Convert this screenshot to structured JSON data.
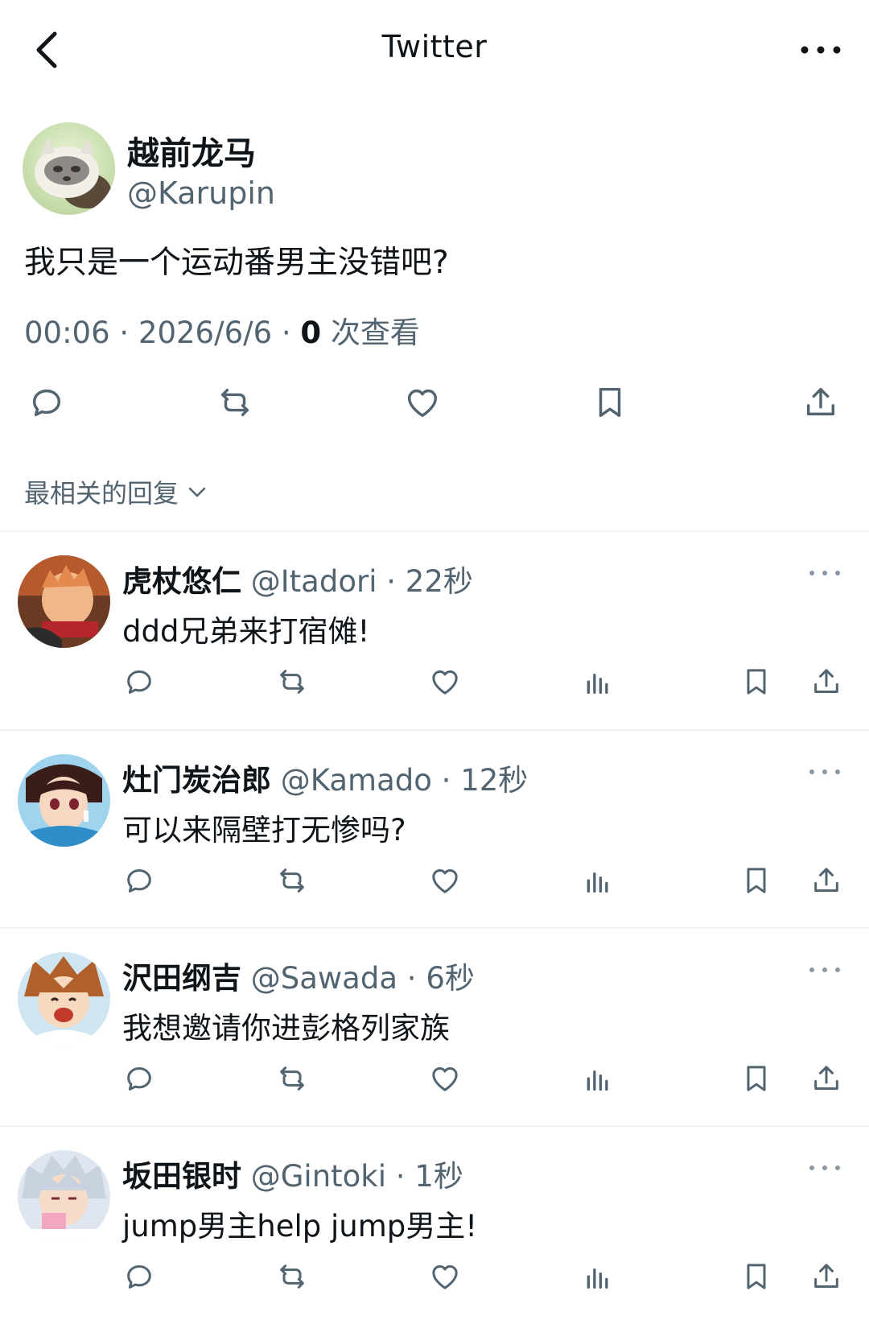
{
  "header": {
    "title": "Twitter"
  },
  "tweet": {
    "author_name": "越前龙马",
    "author_handle": "@Karupin",
    "text": "我只是一个运动番男主没错吧?",
    "time": "00:06",
    "sep1": "·",
    "date": "2026/6/6",
    "sep2": "·",
    "views_count": "0",
    "views_label": "次查看"
  },
  "replies_sort": {
    "label": "最相关的回复"
  },
  "replies": [
    {
      "name": "虎杖悠仁",
      "handle": "@Itadori",
      "dot": "·",
      "time": "22秒",
      "text": "ddd兄弟来打宿傩!"
    },
    {
      "name": "灶门炭治郎",
      "handle": "@Kamado",
      "dot": "·",
      "time": "12秒",
      "text": "可以来隔壁打无惨吗?"
    },
    {
      "name": "沢田纲吉",
      "handle": "@Sawada",
      "dot": "·",
      "time": "6秒",
      "text": "我想邀请你进彭格列家族"
    },
    {
      "name": "坂田银时",
      "handle": "@Gintoki",
      "dot": "·",
      "time": "1秒",
      "text": "jump男主help jump男主!"
    }
  ],
  "colors": {
    "text": "#0f1419",
    "secondary": "#536471",
    "divider": "#eff3f4",
    "background": "#ffffff"
  },
  "icons": [
    "back-arrow-icon",
    "more-horizontal-icon",
    "reply-icon",
    "retweet-icon",
    "like-icon",
    "bookmark-icon",
    "share-icon",
    "views-icon",
    "chevron-down-icon"
  ]
}
